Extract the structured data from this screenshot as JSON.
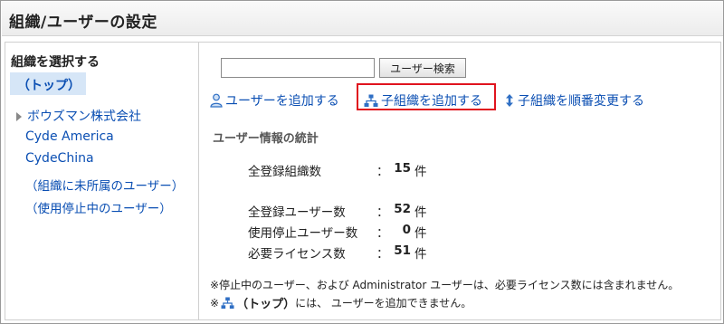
{
  "title": "組織/ユーザーの設定",
  "sidebar": {
    "heading": "組織を選択する",
    "top_item": "（トップ）",
    "orgs": [
      "ボウズマン株式会社",
      "Cyde America",
      "CydeChina"
    ],
    "special": [
      "（組織に未所属のユーザー）",
      "（使用停止中のユーザー）"
    ]
  },
  "search": {
    "value": "",
    "button_label": "ユーザー検索"
  },
  "actions": {
    "add_user": "ユーザーを追加する",
    "add_child_org": "子組織を追加する",
    "reorder_child_org": "子組織を順番変更する"
  },
  "stats": {
    "title": "ユーザー情報の統計",
    "colon": "：",
    "rows": [
      {
        "label": "全登録組織数",
        "value": "15",
        "unit": "件"
      },
      {
        "label": "全登録ユーザー数",
        "value": "52",
        "unit": "件"
      },
      {
        "label": "使用停止ユーザー数",
        "value": "0",
        "unit": "件"
      },
      {
        "label": "必要ライセンス数",
        "value": "51",
        "unit": "件"
      }
    ]
  },
  "notes": {
    "line1": "※停止中のユーザー、および Administrator ユーザーは、必要ライセンス数には含まれません。",
    "line2_prefix": "※",
    "line2_top": "（トップ）",
    "line2_suffix": "には、 ユーザーを追加できません。"
  },
  "colors": {
    "link": "#0b4fb3",
    "selected_bg": "#d6e6f7",
    "highlight_border": "#e0141e"
  },
  "icons": {
    "add_user": "user-icon",
    "add_child_org": "org-tree-icon",
    "reorder": "up-down-arrow-icon",
    "expand": "triangle-right-icon"
  }
}
